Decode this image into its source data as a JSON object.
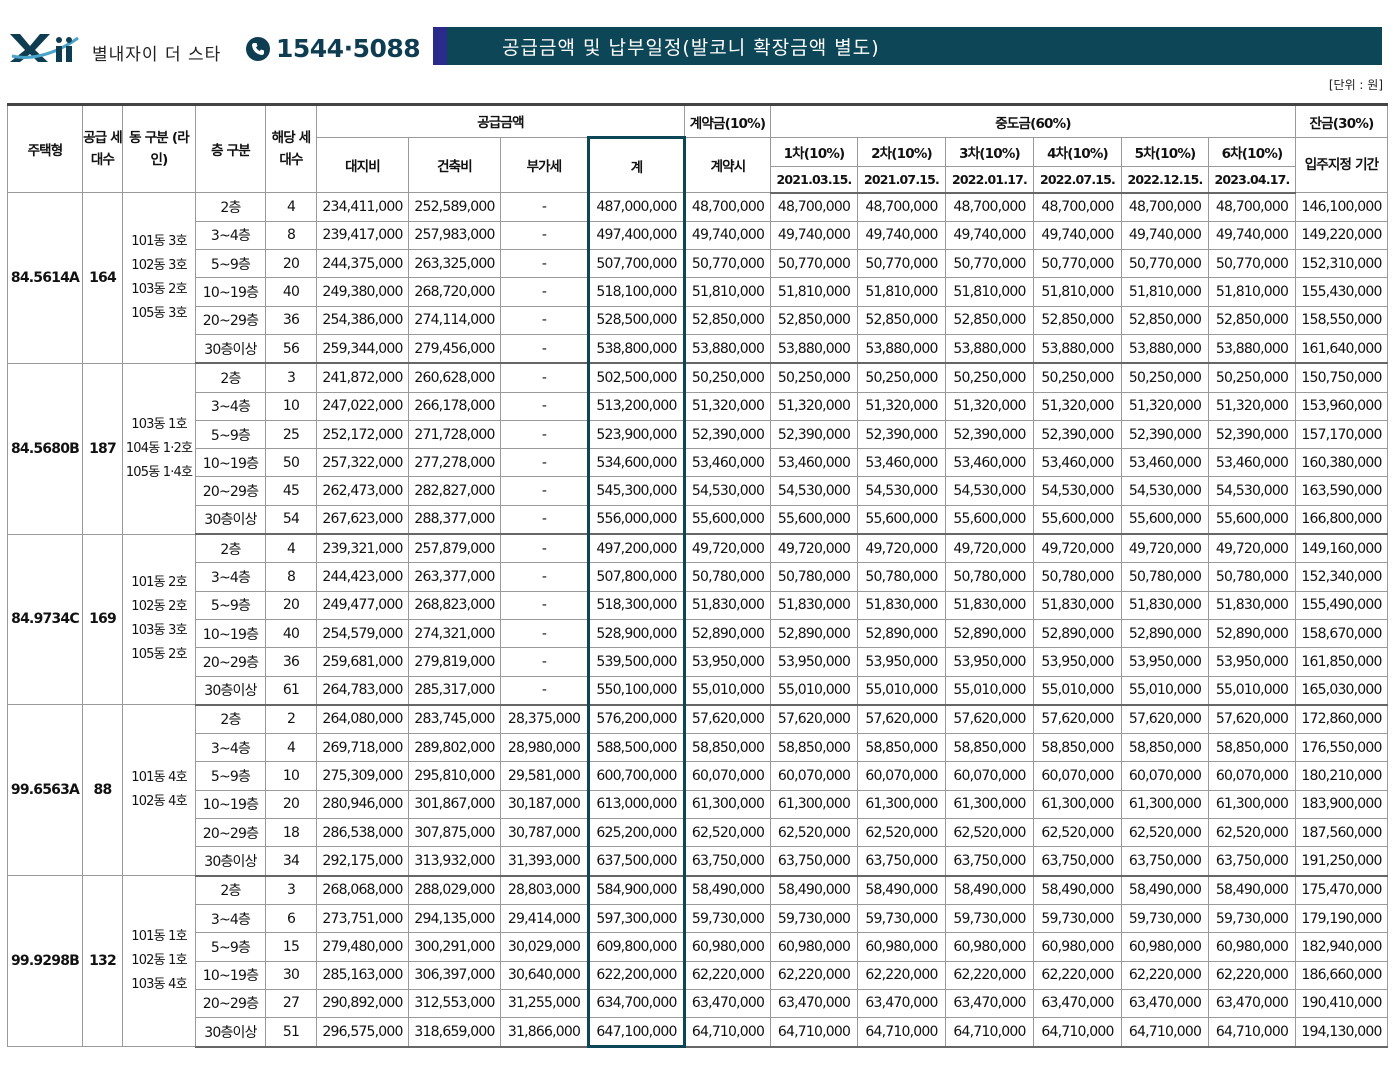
{
  "header": {
    "brand": "별내자이 더 스타",
    "phone": "1544·5088",
    "title": "공급금액 및 납부일정(발코니 확장금액 별도)",
    "unit": "[단위 : 원]",
    "colors": {
      "banner": "#0d4656",
      "accent": "#2a2a8a"
    },
    "icons": [
      "xi-logo",
      "phone-icon"
    ]
  },
  "table": {
    "headers": {
      "type": "주택형",
      "supply_units": "공급 세대수",
      "dong": "동 구분 (라인)",
      "floor": "층 구분",
      "units": "해당 세대수",
      "supply_price": "공급금액",
      "land": "대지비",
      "building": "건축비",
      "vat": "부가세",
      "total": "계",
      "contract": "계약금(10%)",
      "contract_when": "계약시",
      "middle": "중도금(60%)",
      "balance": "잔금(30%)",
      "balance_when": "입주지정 기간",
      "installments": [
        {
          "label": "1차(10%)",
          "date": "2021.03.15."
        },
        {
          "label": "2차(10%)",
          "date": "2021.07.15."
        },
        {
          "label": "3차(10%)",
          "date": "2022.01.17."
        },
        {
          "label": "4차(10%)",
          "date": "2022.07.15."
        },
        {
          "label": "5차(10%)",
          "date": "2022.12.15."
        },
        {
          "label": "6차(10%)",
          "date": "2023.04.17."
        }
      ]
    },
    "groups": [
      {
        "type": "84.5614A",
        "units": "164",
        "dong": [
          "101동 3호",
          "102동 3호",
          "103동 2호",
          "105동 3호"
        ],
        "rows": [
          {
            "floor": "2층",
            "n": "4",
            "land": "234,411,000",
            "bld": "252,589,000",
            "vat": "-",
            "total": "487,000,000",
            "contract": "48,700,000",
            "mid": "48,700,000",
            "bal": "146,100,000"
          },
          {
            "floor": "3~4층",
            "n": "8",
            "land": "239,417,000",
            "bld": "257,983,000",
            "vat": "-",
            "total": "497,400,000",
            "contract": "49,740,000",
            "mid": "49,740,000",
            "bal": "149,220,000"
          },
          {
            "floor": "5~9층",
            "n": "20",
            "land": "244,375,000",
            "bld": "263,325,000",
            "vat": "-",
            "total": "507,700,000",
            "contract": "50,770,000",
            "mid": "50,770,000",
            "bal": "152,310,000"
          },
          {
            "floor": "10~19층",
            "n": "40",
            "land": "249,380,000",
            "bld": "268,720,000",
            "vat": "-",
            "total": "518,100,000",
            "contract": "51,810,000",
            "mid": "51,810,000",
            "bal": "155,430,000"
          },
          {
            "floor": "20~29층",
            "n": "36",
            "land": "254,386,000",
            "bld": "274,114,000",
            "vat": "-",
            "total": "528,500,000",
            "contract": "52,850,000",
            "mid": "52,850,000",
            "bal": "158,550,000"
          },
          {
            "floor": "30층이상",
            "n": "56",
            "land": "259,344,000",
            "bld": "279,456,000",
            "vat": "-",
            "total": "538,800,000",
            "contract": "53,880,000",
            "mid": "53,880,000",
            "bal": "161,640,000"
          }
        ]
      },
      {
        "type": "84.5680B",
        "units": "187",
        "dong": [
          "103동 1호",
          "104동 1·2호",
          "105동 1·4호"
        ],
        "rows": [
          {
            "floor": "2층",
            "n": "3",
            "land": "241,872,000",
            "bld": "260,628,000",
            "vat": "-",
            "total": "502,500,000",
            "contract": "50,250,000",
            "mid": "50,250,000",
            "bal": "150,750,000"
          },
          {
            "floor": "3~4층",
            "n": "10",
            "land": "247,022,000",
            "bld": "266,178,000",
            "vat": "-",
            "total": "513,200,000",
            "contract": "51,320,000",
            "mid": "51,320,000",
            "bal": "153,960,000"
          },
          {
            "floor": "5~9층",
            "n": "25",
            "land": "252,172,000",
            "bld": "271,728,000",
            "vat": "-",
            "total": "523,900,000",
            "contract": "52,390,000",
            "mid": "52,390,000",
            "bal": "157,170,000"
          },
          {
            "floor": "10~19층",
            "n": "50",
            "land": "257,322,000",
            "bld": "277,278,000",
            "vat": "-",
            "total": "534,600,000",
            "contract": "53,460,000",
            "mid": "53,460,000",
            "bal": "160,380,000"
          },
          {
            "floor": "20~29층",
            "n": "45",
            "land": "262,473,000",
            "bld": "282,827,000",
            "vat": "-",
            "total": "545,300,000",
            "contract": "54,530,000",
            "mid": "54,530,000",
            "bal": "163,590,000"
          },
          {
            "floor": "30층이상",
            "n": "54",
            "land": "267,623,000",
            "bld": "288,377,000",
            "vat": "-",
            "total": "556,000,000",
            "contract": "55,600,000",
            "mid": "55,600,000",
            "bal": "166,800,000"
          }
        ]
      },
      {
        "type": "84.9734C",
        "units": "169",
        "dong": [
          "101동 2호",
          "102동 2호",
          "103동 3호",
          "105동 2호"
        ],
        "rows": [
          {
            "floor": "2층",
            "n": "4",
            "land": "239,321,000",
            "bld": "257,879,000",
            "vat": "-",
            "total": "497,200,000",
            "contract": "49,720,000",
            "mid": "49,720,000",
            "bal": "149,160,000"
          },
          {
            "floor": "3~4층",
            "n": "8",
            "land": "244,423,000",
            "bld": "263,377,000",
            "vat": "-",
            "total": "507,800,000",
            "contract": "50,780,000",
            "mid": "50,780,000",
            "bal": "152,340,000"
          },
          {
            "floor": "5~9층",
            "n": "20",
            "land": "249,477,000",
            "bld": "268,823,000",
            "vat": "-",
            "total": "518,300,000",
            "contract": "51,830,000",
            "mid": "51,830,000",
            "bal": "155,490,000"
          },
          {
            "floor": "10~19층",
            "n": "40",
            "land": "254,579,000",
            "bld": "274,321,000",
            "vat": "-",
            "total": "528,900,000",
            "contract": "52,890,000",
            "mid": "52,890,000",
            "bal": "158,670,000"
          },
          {
            "floor": "20~29층",
            "n": "36",
            "land": "259,681,000",
            "bld": "279,819,000",
            "vat": "-",
            "total": "539,500,000",
            "contract": "53,950,000",
            "mid": "53,950,000",
            "bal": "161,850,000"
          },
          {
            "floor": "30층이상",
            "n": "61",
            "land": "264,783,000",
            "bld": "285,317,000",
            "vat": "-",
            "total": "550,100,000",
            "contract": "55,010,000",
            "mid": "55,010,000",
            "bal": "165,030,000"
          }
        ]
      },
      {
        "type": "99.6563A",
        "units": "88",
        "dong": [
          "101동 4호",
          "102동 4호"
        ],
        "rows": [
          {
            "floor": "2층",
            "n": "2",
            "land": "264,080,000",
            "bld": "283,745,000",
            "vat": "28,375,000",
            "total": "576,200,000",
            "contract": "57,620,000",
            "mid": "57,620,000",
            "bal": "172,860,000"
          },
          {
            "floor": "3~4층",
            "n": "4",
            "land": "269,718,000",
            "bld": "289,802,000",
            "vat": "28,980,000",
            "total": "588,500,000",
            "contract": "58,850,000",
            "mid": "58,850,000",
            "bal": "176,550,000"
          },
          {
            "floor": "5~9층",
            "n": "10",
            "land": "275,309,000",
            "bld": "295,810,000",
            "vat": "29,581,000",
            "total": "600,700,000",
            "contract": "60,070,000",
            "mid": "60,070,000",
            "bal": "180,210,000"
          },
          {
            "floor": "10~19층",
            "n": "20",
            "land": "280,946,000",
            "bld": "301,867,000",
            "vat": "30,187,000",
            "total": "613,000,000",
            "contract": "61,300,000",
            "mid": "61,300,000",
            "bal": "183,900,000"
          },
          {
            "floor": "20~29층",
            "n": "18",
            "land": "286,538,000",
            "bld": "307,875,000",
            "vat": "30,787,000",
            "total": "625,200,000",
            "contract": "62,520,000",
            "mid": "62,520,000",
            "bal": "187,560,000"
          },
          {
            "floor": "30층이상",
            "n": "34",
            "land": "292,175,000",
            "bld": "313,932,000",
            "vat": "31,393,000",
            "total": "637,500,000",
            "contract": "63,750,000",
            "mid": "63,750,000",
            "bal": "191,250,000"
          }
        ]
      },
      {
        "type": "99.9298B",
        "units": "132",
        "dong": [
          "101동 1호",
          "102동 1호",
          "103동 4호"
        ],
        "rows": [
          {
            "floor": "2층",
            "n": "3",
            "land": "268,068,000",
            "bld": "288,029,000",
            "vat": "28,803,000",
            "total": "584,900,000",
            "contract": "58,490,000",
            "mid": "58,490,000",
            "bal": "175,470,000"
          },
          {
            "floor": "3~4층",
            "n": "6",
            "land": "273,751,000",
            "bld": "294,135,000",
            "vat": "29,414,000",
            "total": "597,300,000",
            "contract": "59,730,000",
            "mid": "59,730,000",
            "bal": "179,190,000"
          },
          {
            "floor": "5~9층",
            "n": "15",
            "land": "279,480,000",
            "bld": "300,291,000",
            "vat": "30,029,000",
            "total": "609,800,000",
            "contract": "60,980,000",
            "mid": "60,980,000",
            "bal": "182,940,000"
          },
          {
            "floor": "10~19층",
            "n": "30",
            "land": "285,163,000",
            "bld": "306,397,000",
            "vat": "30,640,000",
            "total": "622,200,000",
            "contract": "62,220,000",
            "mid": "62,220,000",
            "bal": "186,660,000"
          },
          {
            "floor": "20~29층",
            "n": "27",
            "land": "290,892,000",
            "bld": "312,553,000",
            "vat": "31,255,000",
            "total": "634,700,000",
            "contract": "63,470,000",
            "mid": "63,470,000",
            "bal": "190,410,000"
          },
          {
            "floor": "30층이상",
            "n": "51",
            "land": "296,575,000",
            "bld": "318,659,000",
            "vat": "31,866,000",
            "total": "647,100,000",
            "contract": "64,710,000",
            "mid": "64,710,000",
            "bal": "194,130,000"
          }
        ]
      }
    ]
  }
}
